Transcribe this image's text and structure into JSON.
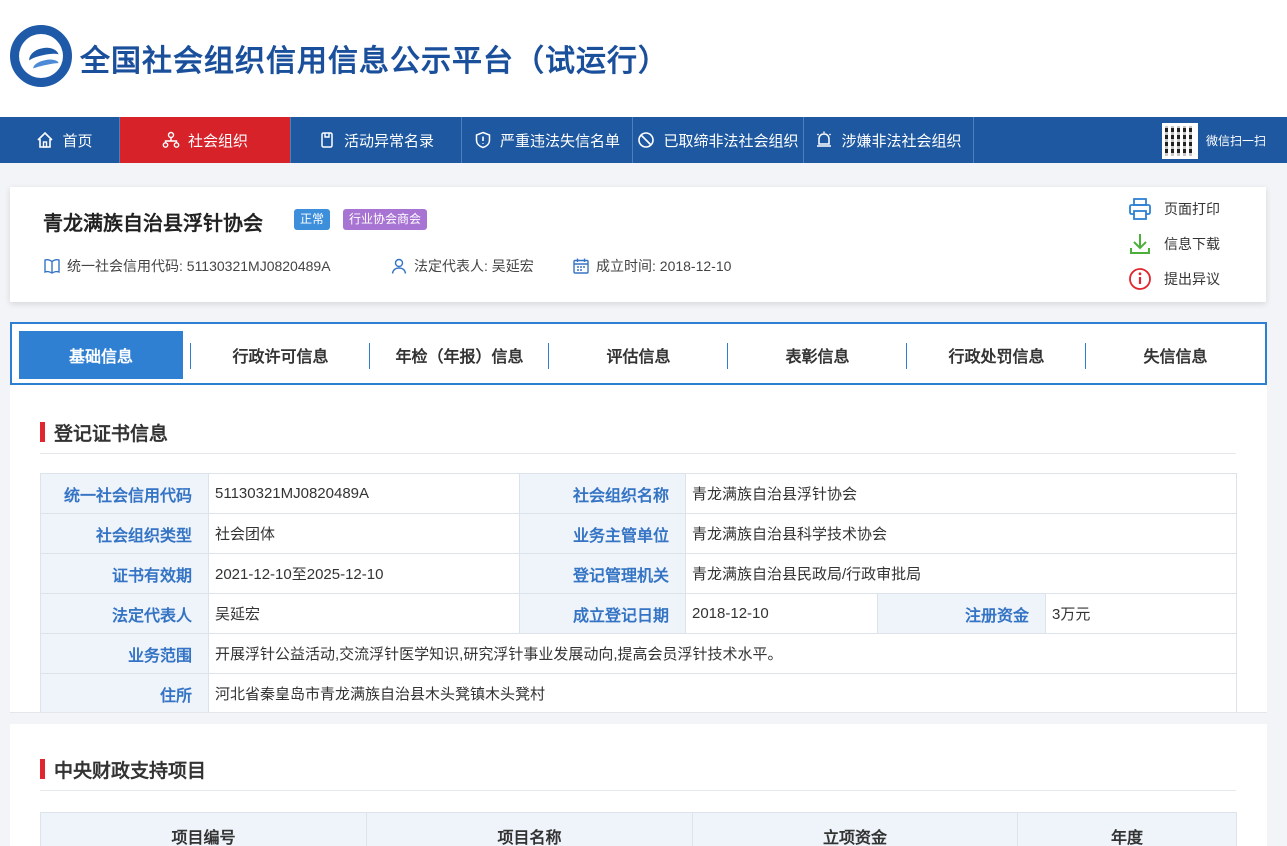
{
  "header": {
    "title": "全国社会组织信用信息公示平台（试运行）"
  },
  "nav": {
    "items": [
      {
        "label": "首页",
        "icon": "home-icon"
      },
      {
        "label": "社会组织",
        "icon": "org-chart-icon",
        "active": true
      },
      {
        "label": "活动异常名录",
        "icon": "document-icon"
      },
      {
        "label": "严重违法失信名单",
        "icon": "shield-icon"
      },
      {
        "label": "已取缔非法社会组织",
        "icon": "ban-icon"
      },
      {
        "label": "涉嫌非法社会组织",
        "icon": "alert-icon"
      }
    ],
    "qr_label": "微信扫一扫",
    "accent": "#1d58a0",
    "active_color": "#d7222a"
  },
  "org": {
    "name": "青龙满族自治县浮针协会",
    "status_badge": "正常",
    "type_badge": "行业协会商会",
    "credit_code": "统一社会信用代码: 51130321MJ0820489A",
    "legal_rep": "法定代表人: 吴延宏",
    "founded": "成立时间: 2018-12-10",
    "actions": {
      "print": "页面打印",
      "download": "信息下载",
      "objection": "提出异议"
    }
  },
  "tabs": [
    "基础信息",
    "行政许可信息",
    "年检（年报）信息",
    "评估信息",
    "表彰信息",
    "行政处罚信息",
    "失信信息"
  ],
  "cert": {
    "title": "登记证书信息",
    "rows": {
      "credit_code_k": "统一社会信用代码",
      "credit_code_v": "51130321MJ0820489A",
      "org_name_k": "社会组织名称",
      "org_name_v": "青龙满族自治县浮针协会",
      "org_type_k": "社会组织类型",
      "org_type_v": "社会团体",
      "supervisor_k": "业务主管单位",
      "supervisor_v": "青龙满族自治县科学技术协会",
      "validity_k": "证书有效期",
      "validity_v": "2021-12-10至2025-12-10",
      "registrar_k": "登记管理机关",
      "registrar_v": "青龙满族自治县民政局/行政审批局",
      "legal_rep_k": "法定代表人",
      "legal_rep_v": "吴延宏",
      "reg_date_k": "成立登记日期",
      "reg_date_v": "2018-12-10",
      "capital_k": "注册资金",
      "capital_v": "3万元",
      "scope_k": "业务范围",
      "scope_v": "开展浮针公益活动,交流浮针医学知识,研究浮针事业发展动向,提高会员浮针技术水平。",
      "address_k": "住所",
      "address_v": "河北省秦皇岛市青龙满族自治县木头凳镇木头凳村"
    }
  },
  "projects": {
    "title": "中央财政支持项目",
    "columns": [
      "项目编号",
      "项目名称",
      "立项资金",
      "年度"
    ]
  }
}
